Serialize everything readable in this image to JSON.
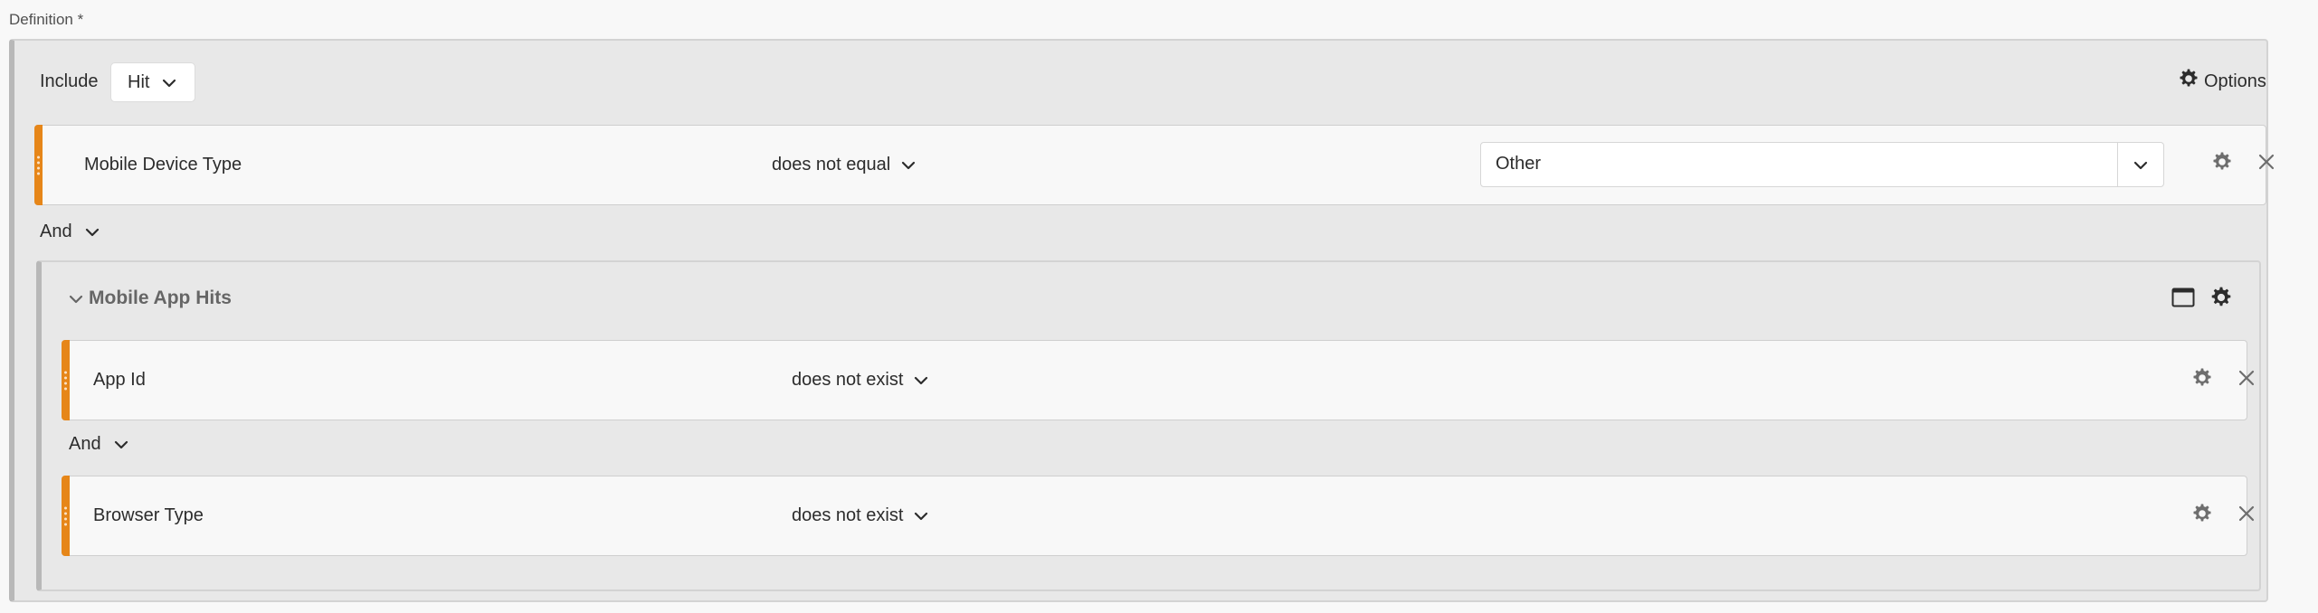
{
  "definition": {
    "label": "Definition *"
  },
  "header": {
    "include_label": "Include",
    "scope_value": "Hit",
    "options_label": "Options"
  },
  "rules": [
    {
      "dimension": "Mobile Device Type",
      "operator": "does not equal",
      "value": "Other"
    }
  ],
  "connectors": {
    "and_top": "And",
    "and_inner": "And"
  },
  "container": {
    "title": "Mobile App Hits",
    "rules": [
      {
        "dimension": "App Id",
        "operator": "does not exist"
      },
      {
        "dimension": "Browser Type",
        "operator": "does not exist"
      }
    ]
  },
  "colors": {
    "accent": "#e68619",
    "background": "#e8e8e8",
    "rule_bg": "#f8f8f8"
  }
}
